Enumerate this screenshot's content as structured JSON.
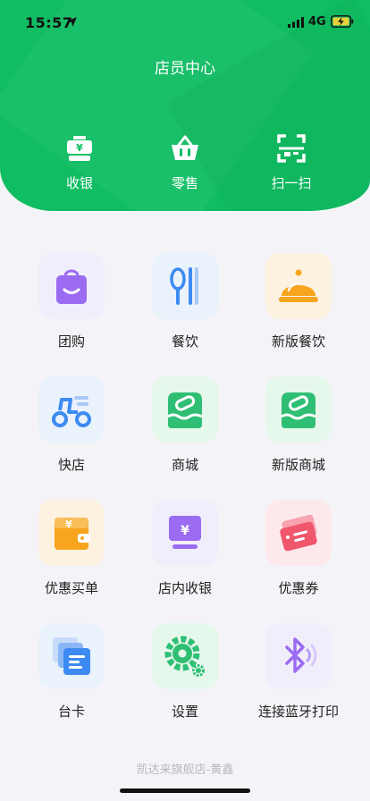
{
  "status_bar": {
    "time": "15:57",
    "network": "4G"
  },
  "header": {
    "title": "店员中心"
  },
  "quick_actions": [
    {
      "label": "收银",
      "icon": "cash-register-icon"
    },
    {
      "label": "零售",
      "icon": "basket-icon"
    },
    {
      "label": "扫一扫",
      "icon": "scan-icon"
    }
  ],
  "grid": [
    {
      "label": "团购",
      "icon": "shopping-bag-icon",
      "color": "#9b6bf2",
      "bg": "#f1eefb"
    },
    {
      "label": "餐饮",
      "icon": "spoon-fork-icon",
      "color": "#3d8bf2",
      "bg": "#eaf2fc"
    },
    {
      "label": "新版餐饮",
      "icon": "cloche-icon",
      "color": "#f7a51e",
      "bg": "#fdf1e0"
    },
    {
      "label": "快店",
      "icon": "scooter-icon",
      "color": "#3d8bf2",
      "bg": "#eaf2fc"
    },
    {
      "label": "商城",
      "icon": "store-icon",
      "color": "#2fbf74",
      "bg": "#e6f7ec"
    },
    {
      "label": "新版商城",
      "icon": "store-icon",
      "color": "#2fbf74",
      "bg": "#e6f7ec"
    },
    {
      "label": "优惠买单",
      "icon": "wallet-icon",
      "color": "#f7a51e",
      "bg": "#fdf1e0"
    },
    {
      "label": "店内收银",
      "icon": "pos-terminal-icon",
      "color": "#9b6bf2",
      "bg": "#f1eefb"
    },
    {
      "label": "优惠券",
      "icon": "ticket-icon",
      "color": "#f0566c",
      "bg": "#fde9ec"
    },
    {
      "label": "台卡",
      "icon": "cards-icon",
      "color": "#3d8bf2",
      "bg": "#eaf2fc"
    },
    {
      "label": "设置",
      "icon": "gear-icon",
      "color": "#2fbf74",
      "bg": "#e6f7ec"
    },
    {
      "label": "连接蓝牙打印",
      "icon": "bluetooth-icon",
      "color": "#9b6bf2",
      "bg": "#f1eefb"
    }
  ],
  "footer": {
    "text": "凯达来旗舰店-黄鑫"
  }
}
